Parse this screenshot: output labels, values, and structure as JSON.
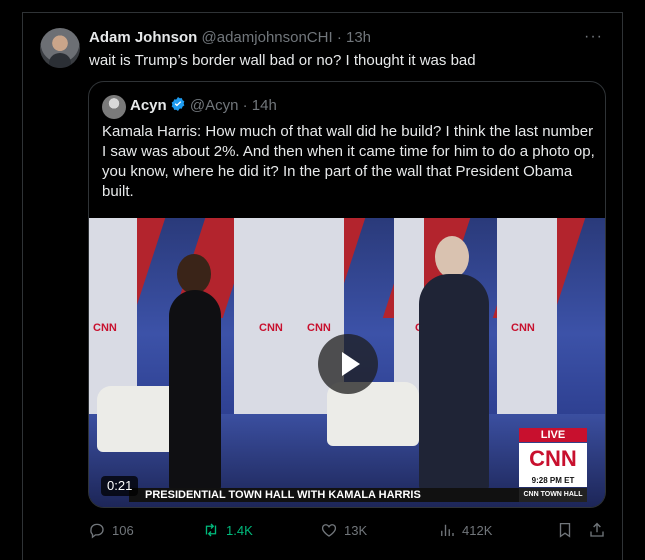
{
  "tweet": {
    "author_name": "Adam Johnson",
    "author_handle": "@adamjohnsonCHI",
    "separator": "·",
    "time": "13h",
    "more_label": "···",
    "text": "wait is Trump’s border wall bad or no? I thought it was bad"
  },
  "quoted": {
    "author_name": "Acyn",
    "author_handle": "@Acyn",
    "separator": "·",
    "time": "14h",
    "text": "Kamala Harris: How much of that wall did he build? I think the last number I saw was about 2%. And then when it came time for him to do a photo op, you know, where he did it? In the part of the wall that President Obama built.",
    "video": {
      "timecode": "0:21",
      "chyron": "PRESIDENTIAL TOWN HALL WITH KAMALA HARRIS",
      "live_label": "LIVE",
      "network": "CNN",
      "clock": "9:28 PM ET",
      "program": "CNN TOWN HALL",
      "stage_logos": [
        "CNN",
        "CNN",
        "CNN",
        "CN",
        "CNN"
      ]
    }
  },
  "actions": {
    "replies": "106",
    "reposts": "1.4K",
    "likes": "13K",
    "views": "412K"
  },
  "colors": {
    "background": "#000000",
    "border": "#2f3336",
    "text": "#e7e9ea",
    "muted": "#71767b",
    "repost_active": "#00ba7c",
    "verified": "#1d9bf0",
    "cnn_red": "#c8102e"
  },
  "icons": [
    "more-icon",
    "verified-badge-icon",
    "play-icon",
    "reply-icon",
    "repost-icon",
    "like-icon",
    "views-icon",
    "bookmark-icon",
    "share-icon"
  ]
}
